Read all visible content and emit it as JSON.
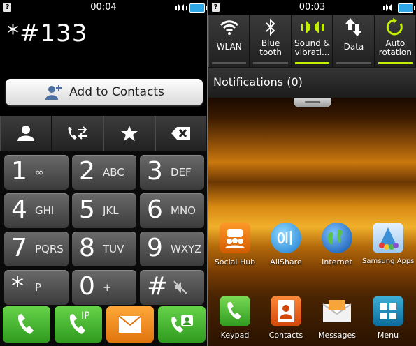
{
  "left_screen": {
    "status": {
      "time": "00:04"
    },
    "dial_number": "*#133",
    "add_contacts_label": "Add to Contacts",
    "keys": [
      {
        "digit": "1",
        "letters": "∞"
      },
      {
        "digit": "2",
        "letters": "ABC"
      },
      {
        "digit": "3",
        "letters": "DEF"
      },
      {
        "digit": "4",
        "letters": "GHI"
      },
      {
        "digit": "5",
        "letters": "JKL"
      },
      {
        "digit": "6",
        "letters": "MNO"
      },
      {
        "digit": "7",
        "letters": "PQRS"
      },
      {
        "digit": "8",
        "letters": "TUV"
      },
      {
        "digit": "9",
        "letters": "WXYZ"
      },
      {
        "digit": "*",
        "letters": "P"
      },
      {
        "digit": "0",
        "letters": "+"
      },
      {
        "digit": "#",
        "letters": ""
      }
    ],
    "ip_call_label": "IP"
  },
  "right_screen": {
    "status": {
      "time": "00:03"
    },
    "quick_toggles": [
      {
        "label": "WLAN",
        "icon": "wifi-icon",
        "active": false
      },
      {
        "label": "Blue\ntooth",
        "icon": "bluetooth-icon",
        "active": false
      },
      {
        "label": "Sound &\nvibrati...",
        "icon": "sound-vibration-icon",
        "active": true
      },
      {
        "label": "Data",
        "icon": "data-arrows-icon",
        "active": false
      },
      {
        "label": "Auto\nrotation",
        "icon": "rotation-icon",
        "active": true
      }
    ],
    "notifications_title": "Notifications (0)",
    "apps": [
      {
        "label": "Social Hub",
        "icon": "social-hub-icon"
      },
      {
        "label": "AllShare",
        "icon": "allshare-icon"
      },
      {
        "label": "Internet",
        "icon": "internet-globe-icon"
      },
      {
        "label": "Samsung Apps",
        "icon": "samsung-apps-icon"
      }
    ],
    "dock": [
      {
        "label": "Keypad",
        "icon": "phone-icon"
      },
      {
        "label": "Contacts",
        "icon": "contacts-icon"
      },
      {
        "label": "Messages",
        "icon": "messages-icon"
      },
      {
        "label": "Menu",
        "icon": "menu-grid-icon"
      }
    ]
  },
  "colors": {
    "accent_green": "#c3f000",
    "call_green": "#3fb52a",
    "message_orange": "#f08a1a",
    "battery_blue": "#2fa7e6"
  }
}
